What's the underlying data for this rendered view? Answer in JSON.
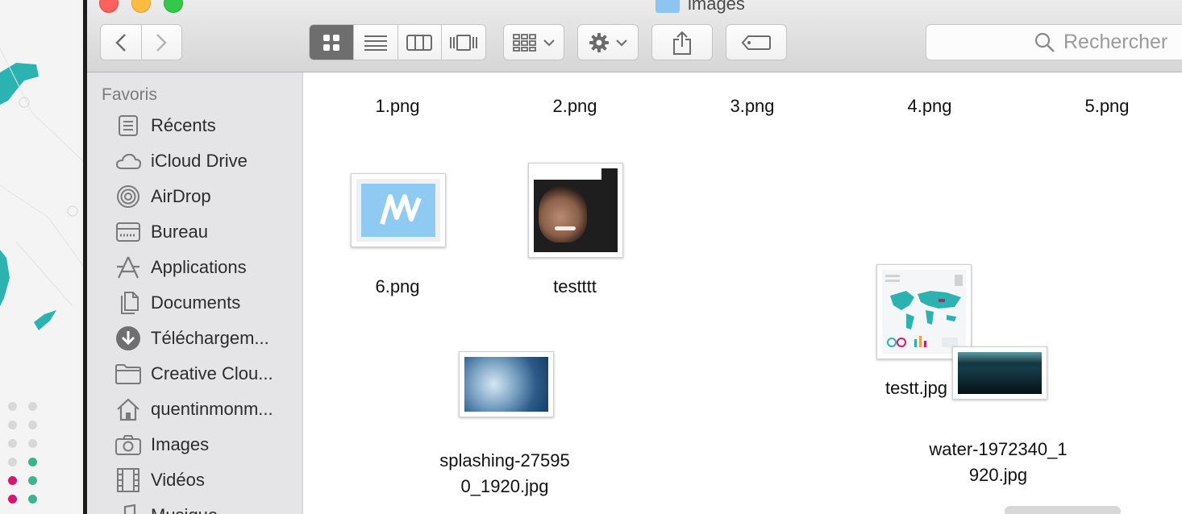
{
  "window": {
    "title": "images",
    "title_icon": "folder-icon"
  },
  "toolbar": {
    "back_icon": "chevron-left-icon",
    "forward_icon": "chevron-right-icon",
    "view_modes": [
      "icon-view-icon",
      "list-view-icon",
      "column-view-icon",
      "cover-flow-icon"
    ],
    "active_view": "icon-view-icon",
    "arrange_icon": "group-grid-icon",
    "action_icon": "gear-icon",
    "share_icon": "share-icon",
    "tag_icon": "tag-icon",
    "search_placeholder": "Rechercher"
  },
  "sidebar": {
    "heading": "Favoris",
    "items": [
      {
        "label": "Récents",
        "icon": "recents-icon"
      },
      {
        "label": "iCloud Drive",
        "icon": "cloud-icon"
      },
      {
        "label": "AirDrop",
        "icon": "airdrop-icon"
      },
      {
        "label": "Bureau",
        "icon": "desktop-icon"
      },
      {
        "label": "Applications",
        "icon": "applications-icon"
      },
      {
        "label": "Documents",
        "icon": "documents-icon"
      },
      {
        "label": "Téléchargem...",
        "icon": "download-icon"
      },
      {
        "label": "Creative Clou...",
        "icon": "folder-icon"
      },
      {
        "label": "quentinmonm...",
        "icon": "home-icon"
      },
      {
        "label": "Images",
        "icon": "camera-icon"
      },
      {
        "label": "Vidéos",
        "icon": "film-icon"
      },
      {
        "label": "Musique",
        "icon": "music-icon"
      }
    ]
  },
  "files": [
    {
      "name": "1.png"
    },
    {
      "name": "2.png"
    },
    {
      "name": "3.png"
    },
    {
      "name": "4.png"
    },
    {
      "name": "5.png"
    },
    {
      "name": "6.png"
    },
    {
      "name": "testttt"
    },
    {
      "name": "testt.jpg"
    },
    {
      "name_line1": "splashing-27595",
      "name_line2": "0_1920.jpg"
    },
    {
      "name_line1": "water-1972340_1",
      "name_line2": "920.jpg"
    }
  ],
  "colors": {
    "close": "#fc615d",
    "minimize": "#fdbc40",
    "maximize": "#34c84a",
    "sidebar_bg": "#e5e5e8",
    "active_segment": "#6e6e6e"
  }
}
